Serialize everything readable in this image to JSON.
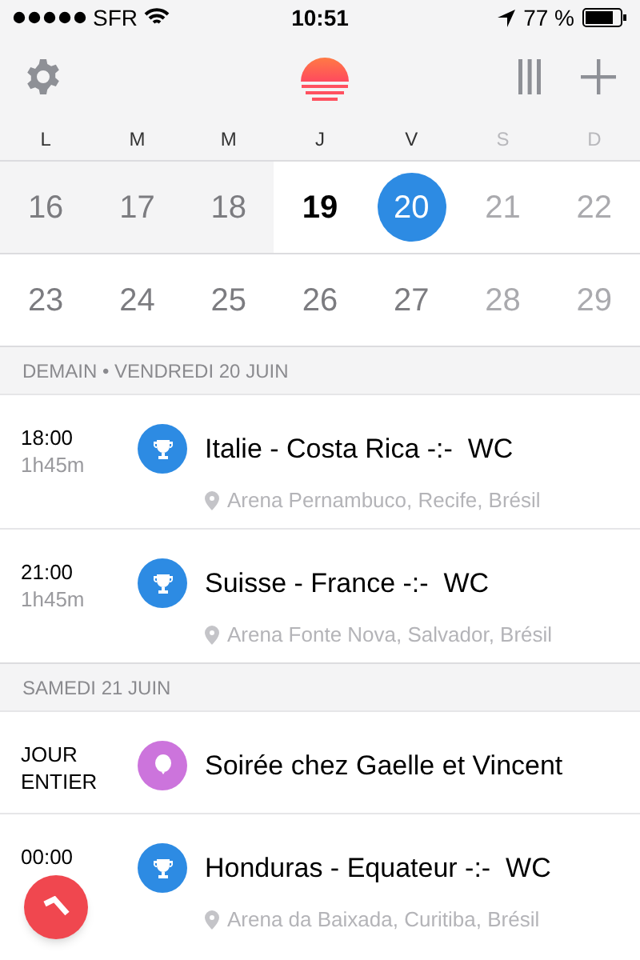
{
  "status_bar": {
    "carrier": "SFR",
    "time": "10:51",
    "battery": "77 %"
  },
  "weekdays": [
    {
      "label": "L",
      "weekend": false
    },
    {
      "label": "M",
      "weekend": false
    },
    {
      "label": "M",
      "weekend": false
    },
    {
      "label": "J",
      "weekend": false
    },
    {
      "label": "V",
      "weekend": false
    },
    {
      "label": "S",
      "weekend": true
    },
    {
      "label": "D",
      "weekend": true
    }
  ],
  "weeks": [
    [
      {
        "day": "16",
        "kind": "past",
        "selected": false
      },
      {
        "day": "17",
        "kind": "past",
        "selected": false
      },
      {
        "day": "18",
        "kind": "past",
        "selected": false
      },
      {
        "day": "19",
        "kind": "today",
        "selected": false
      },
      {
        "day": "20",
        "kind": "future",
        "selected": true
      },
      {
        "day": "21",
        "kind": "future",
        "selected": false
      },
      {
        "day": "22",
        "kind": "future",
        "selected": false
      }
    ],
    [
      {
        "day": "23",
        "kind": "future",
        "selected": false
      },
      {
        "day": "24",
        "kind": "future",
        "selected": false
      },
      {
        "day": "25",
        "kind": "future",
        "selected": false
      },
      {
        "day": "26",
        "kind": "future",
        "selected": false
      },
      {
        "day": "27",
        "kind": "future",
        "selected": false
      },
      {
        "day": "28",
        "kind": "future",
        "selected": false
      },
      {
        "day": "29",
        "kind": "future",
        "selected": false
      }
    ]
  ],
  "agenda": [
    {
      "header": "DEMAIN • VENDREDI 20 JUIN",
      "events": [
        {
          "time": "18:00",
          "duration": "1h45m",
          "title": "Italie - Costa Rica -:-  WC",
          "location": "Arena Pernambuco, Recife, Brésil",
          "kind": "trophy",
          "color": "#2d8be3"
        },
        {
          "time": "21:00",
          "duration": "1h45m",
          "title": "Suisse - France -:-  WC",
          "location": "Arena Fonte Nova, Salvador, Brésil",
          "kind": "trophy",
          "color": "#2d8be3"
        }
      ]
    },
    {
      "header": "SAMEDI 21 JUIN",
      "events": [
        {
          "time": "JOUR ENTIER",
          "title": "Soirée chez Gaelle et Vincent",
          "kind": "balloon",
          "color": "#cc74dc"
        },
        {
          "time": "00:00",
          "title": "Honduras - Equateur -:-  WC",
          "location": "Arena da Baixada, Curitiba, Brésil",
          "kind": "trophy",
          "color": "#2d8be3"
        }
      ]
    }
  ]
}
